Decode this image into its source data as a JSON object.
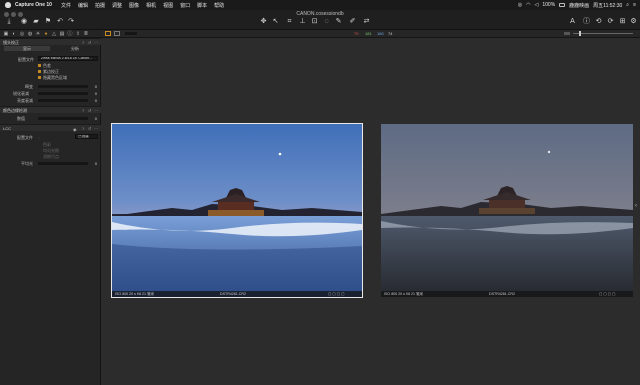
{
  "menubar": {
    "app": "Capture One 10",
    "items": [
      "文件",
      "编辑",
      "拍摄",
      "调整",
      "图像",
      "相机",
      "视图",
      "窗口",
      "脚本",
      "帮助"
    ],
    "battery": "100%",
    "user": "鹿鹿映画",
    "clock": "周五11:52:30"
  },
  "toolbar": {
    "document_title": "CANON.cosessiondb"
  },
  "viewer_strip": {
    "values": [
      "79",
      "181",
      "180",
      "74"
    ]
  },
  "panel": {
    "section1": {
      "title": "镜头校正",
      "tabs": [
        "显示",
        "分析"
      ],
      "profile_label": "配置文件",
      "profile_value": "Zeiss Milvus 2.8/18 ZE Canon...",
      "checks": [
        "色差",
        "紫边校正",
        "隐藏黑色区域"
      ],
      "sliders": [
        {
          "label": "畸变",
          "value": "0"
        },
        {
          "label": "锐化衰减",
          "value": "0"
        },
        {
          "label": "亮度衰减",
          "value": "0"
        }
      ]
    },
    "section2": {
      "title": "颜色边缘检测",
      "slider_label": "数值",
      "slider_value": "0"
    },
    "section3": {
      "title": "LCC",
      "profile_label": "配置文件",
      "profile_value": "已创建",
      "options": [
        "色彩",
        "均匀光照",
        "消除污点"
      ],
      "slider_label": "平均光",
      "slider_value": "0"
    }
  },
  "photos": [
    {
      "caption_left": "ISO 800  20 s  f/8  21 毫米",
      "caption_center": "DSTR4281.CR2"
    },
    {
      "caption_left": "ISO 800  20 s  f/8  21 毫米",
      "caption_center": "DSTR4281.CR2"
    }
  ],
  "colors": {
    "accent": "#c88a23",
    "selected_border": "#e8e8e8"
  }
}
